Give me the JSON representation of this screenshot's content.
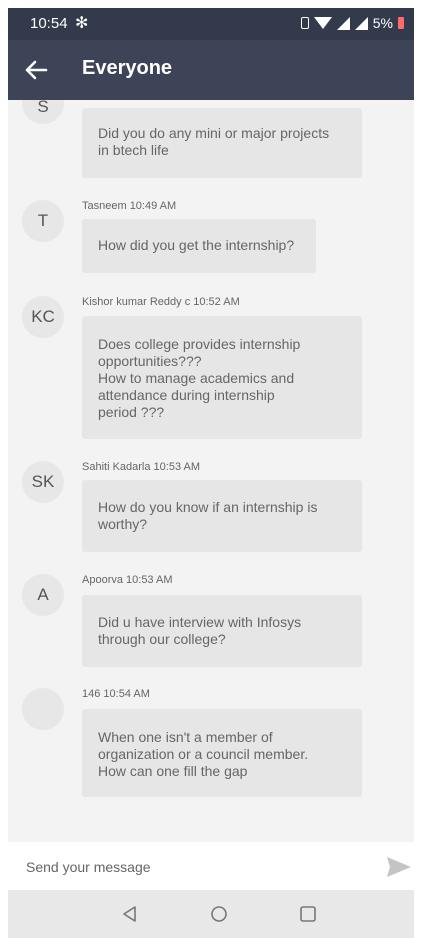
{
  "status_bar": {
    "time": "10:54",
    "battery": "5%",
    "fan_glyph": "✻"
  },
  "app_bar": {
    "title": "Everyone",
    "back_icon": "arrow-left-icon"
  },
  "messages": [
    {
      "initials": "S",
      "sender": "",
      "time": "",
      "meta": "",
      "text": "Did you do any mini or major projects\nin btech life"
    },
    {
      "initials": "T",
      "sender": "Tasneem",
      "time": "10:49 AM",
      "meta": "Tasneem 10:49 AM",
      "text": "How did you get the internship?"
    },
    {
      "initials": "KC",
      "sender": "Kishor kumar Reddy c",
      "time": "10:52 AM",
      "meta": "Kishor kumar Reddy c 10:52 AM",
      "text": "Does college provides internship\nopportunities???\nHow to manage academics and\nattendance during internship\nperiod ???"
    },
    {
      "initials": "SK",
      "sender": "Sahiti Kadarla",
      "time": "10:53 AM",
      "meta": "Sahiti Kadarla 10:53 AM",
      "text": "How do you know if an internship is\nworthy?"
    },
    {
      "initials": "A",
      "sender": "Apoorva",
      "time": "10:53 AM",
      "meta": "Apoorva 10:53 AM",
      "text": "Did u have interview with Infosys\nthrough our college?"
    },
    {
      "initials": "",
      "sender": "146",
      "time": "10:54 AM",
      "meta": "146 10:54 AM",
      "text": "When one isn't a member of\norganization or  a council member.\nHow can one fill the gap"
    }
  ],
  "composer": {
    "placeholder": "Send your message",
    "value": "",
    "send_icon": "send-icon"
  },
  "nav_bar": {
    "back": "nav-back-icon",
    "home": "nav-home-icon",
    "recents": "nav-recents-icon"
  },
  "colors": {
    "status_bar": "#333a4c",
    "app_bar": "#3d4457",
    "background": "#f3f3f3",
    "bubble": "#e6e6e6",
    "avatar": "#e7e7e7"
  }
}
